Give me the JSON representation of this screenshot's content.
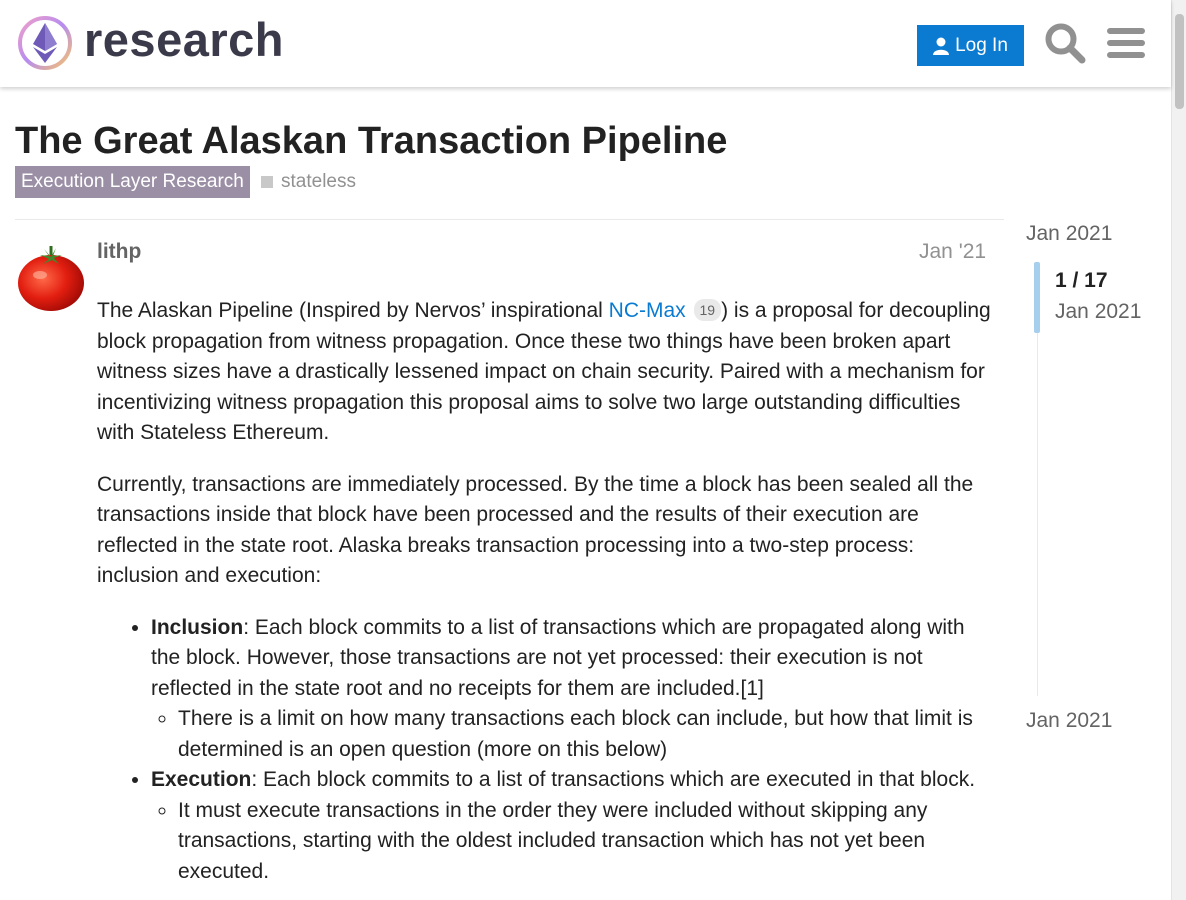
{
  "header": {
    "site_name": "research",
    "login_label": "Log In"
  },
  "topic": {
    "title": "The Great Alaskan Transaction Pipeline",
    "category": "Execution Layer Research",
    "tag": "stateless"
  },
  "post": {
    "username": "lithp",
    "date": "Jan '21",
    "p1_before": "The Alaskan Pipeline (Inspired by Nervos’ inspirational ",
    "p1_link": "NC-Max",
    "p1_link_clicks": "19",
    "p1_after": ") is a proposal for decoupling block propagation from witness propagation. Once these two things have been broken apart witness sizes have a drastically lessened impact on chain security. Paired with a mechanism for incentivizing witness propagation this proposal aims to solve two large outstanding difficulties with Stateless Ethereum.",
    "p2": "Currently, transactions are immediately processed. By the time a block has been sealed all the transactions inside that block have been processed and the results of their execution are reflected in the state root. Alaska breaks transaction processing into a two-step process: inclusion and execution:",
    "inclusion_term": "Inclusion",
    "inclusion_text": ": Each block commits to a list of transactions which are propagated along with the block. However, those transactions are not yet processed: their execution is not reflected in the state root and no receipts for them are included.[1]",
    "inclusion_sub": "There is a limit on how many transactions each block can include, but how that limit is determined is an open question (more on this below)",
    "execution_term": "Execution",
    "execution_text": ": Each block commits to a list of transactions which are executed in that block.",
    "execution_sub": "It must execute transactions in the order they were included without skipping any transactions, starting with the oldest included transaction which has not yet been executed."
  },
  "timeline": {
    "start_date": "Jan 2021",
    "position": "1 / 17",
    "current_date": "Jan 2021",
    "end_date": "Jan 2021"
  },
  "colors": {
    "accent": "#0a7bd1",
    "category": "#9b8fa6",
    "muted": "#919191"
  }
}
